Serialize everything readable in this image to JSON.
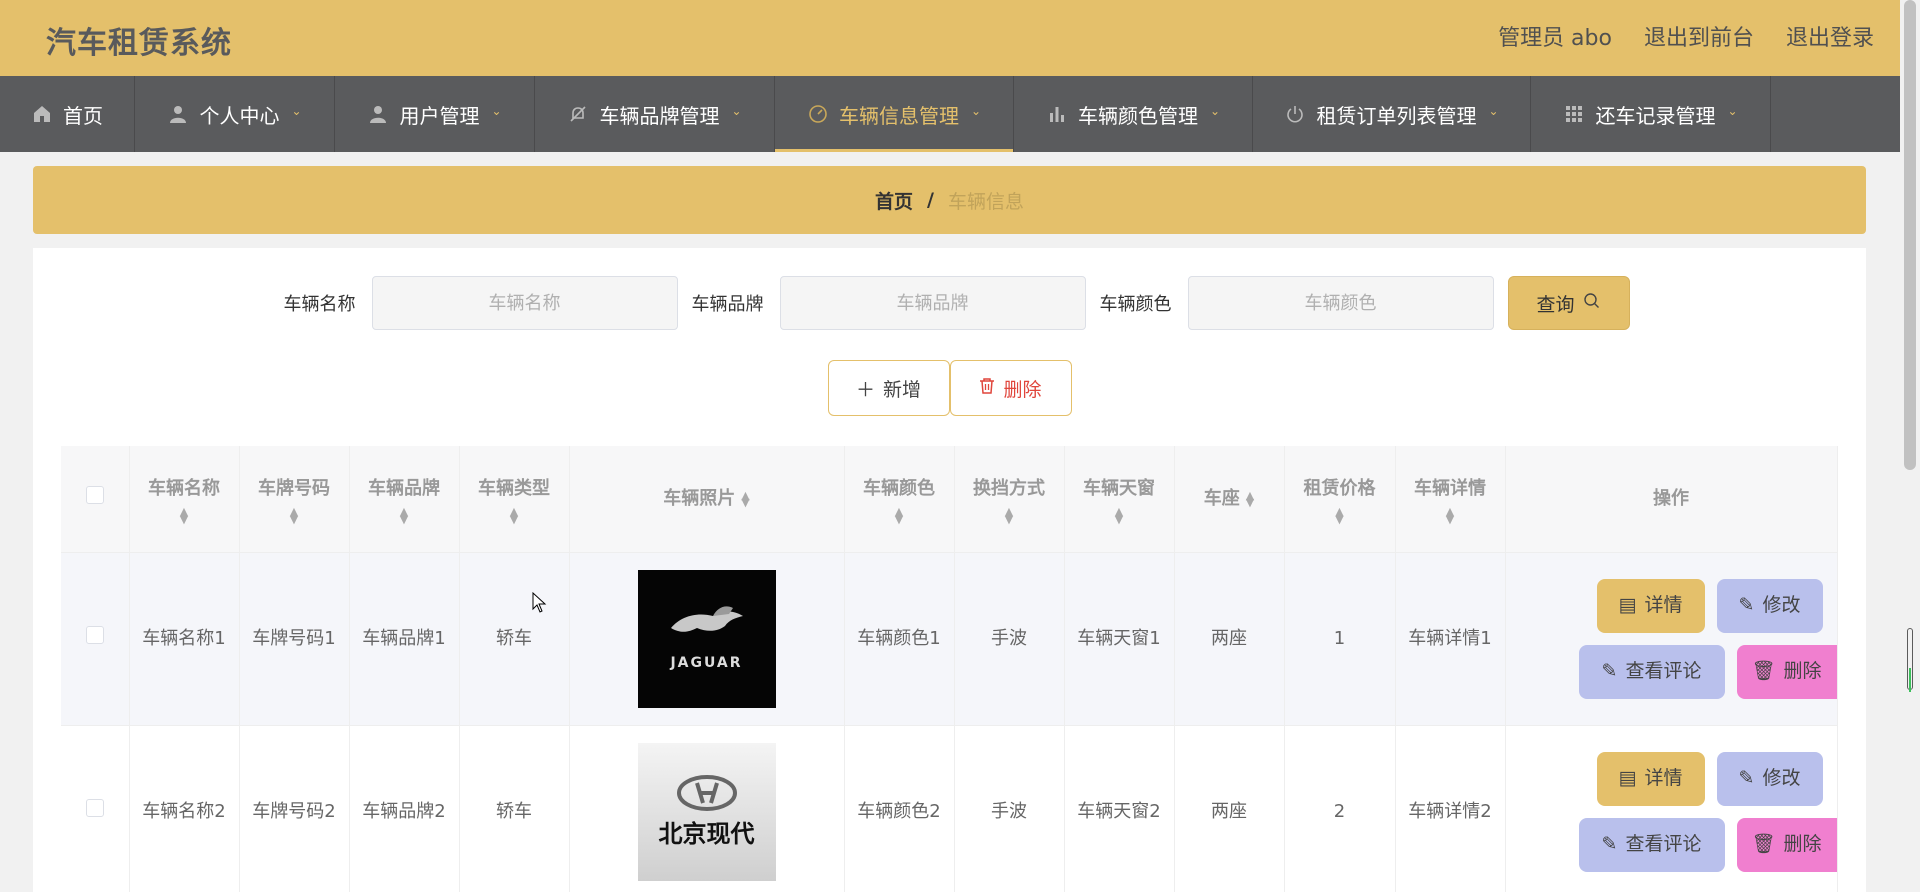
{
  "header": {
    "title": "汽车租赁系统",
    "admin": "管理员 abo",
    "to_front": "退出到前台",
    "logout": "退出登录"
  },
  "nav": [
    {
      "label": "首页",
      "icon": "home-icon"
    },
    {
      "label": "个人中心",
      "icon": "user-icon"
    },
    {
      "label": "用户管理",
      "icon": "user-icon"
    },
    {
      "label": "车辆品牌管理",
      "icon": "bell-off-icon"
    },
    {
      "label": "车辆信息管理",
      "icon": "gauge-icon",
      "active": true
    },
    {
      "label": "车辆颜色管理",
      "icon": "bar-chart-icon"
    },
    {
      "label": "租赁订单列表管理",
      "icon": "power-icon"
    },
    {
      "label": "还车记录管理",
      "icon": "grid-icon"
    }
  ],
  "breadcrumb": {
    "home": "首页",
    "sep": "/",
    "current": "车辆信息"
  },
  "search": {
    "name_label": "车辆名称",
    "name_placeholder": "车辆名称",
    "brand_label": "车辆品牌",
    "brand_placeholder": "车辆品牌",
    "color_label": "车辆颜色",
    "color_placeholder": "车辆颜色",
    "query_label": "查询"
  },
  "actions": {
    "add_label": "新增",
    "delete_label": "删除"
  },
  "table": {
    "headers": {
      "name": "车辆名称",
      "plate": "车牌号码",
      "brand": "车辆品牌",
      "type": "车辆类型",
      "photo": "车辆照片",
      "color": "车辆颜色",
      "gear": "换挡方式",
      "sunroof": "车辆天窗",
      "seat": "车座",
      "price": "租赁价格",
      "detail": "车辆详情",
      "ops": "操作"
    },
    "rows": [
      {
        "name": "车辆名称1",
        "plate": "车牌号码1",
        "brand": "车辆品牌1",
        "type": "轿车",
        "photo_text": "JAGUAR",
        "color": "车辆颜色1",
        "gear": "手波",
        "sunroof": "车辆天窗1",
        "seat": "两座",
        "price": "1",
        "detail": "车辆详情1"
      },
      {
        "name": "车辆名称2",
        "plate": "车牌号码2",
        "brand": "车辆品牌2",
        "type": "轿车",
        "photo_text": "北京现代",
        "color": "车辆颜色2",
        "gear": "手波",
        "sunroof": "车辆天窗2",
        "seat": "两座",
        "price": "2",
        "detail": "车辆详情2"
      }
    ],
    "op_labels": {
      "detail": "详情",
      "edit": "修改",
      "comment": "查看评论",
      "delete": "删除"
    }
  },
  "colors": {
    "accent": "#e4c06b",
    "nav_bg": "#5a5b5d",
    "edit": "#b9c0ec",
    "delete": "#f07fcf"
  }
}
